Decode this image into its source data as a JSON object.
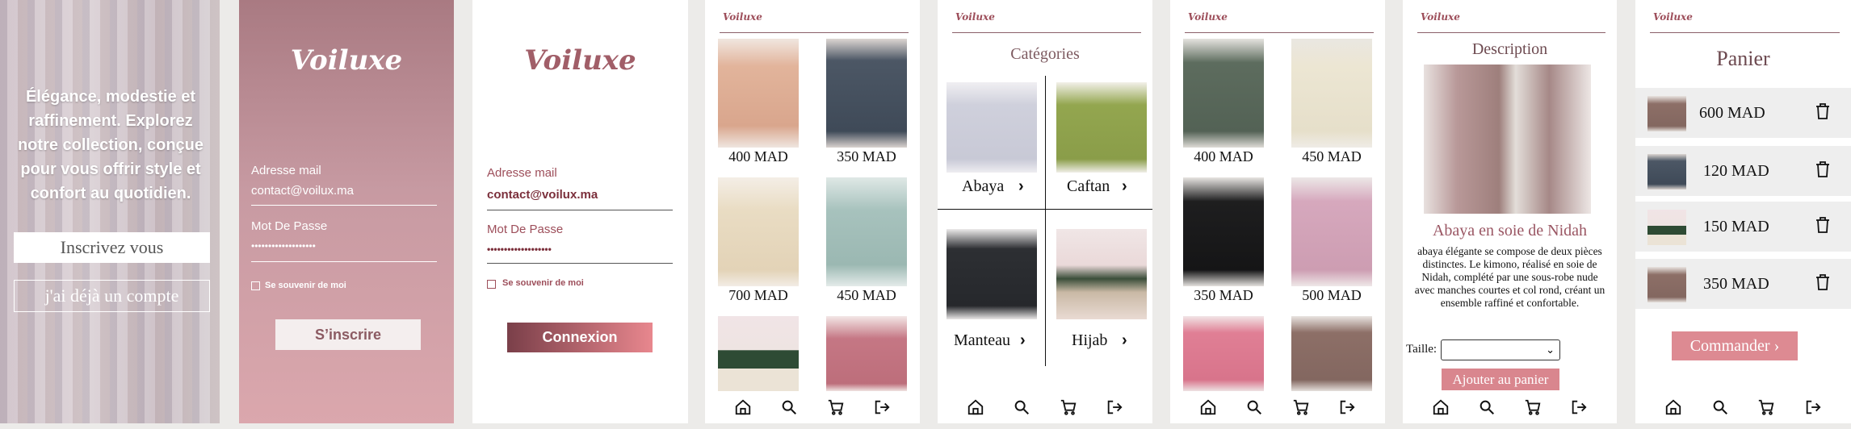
{
  "brand": "Voiluxe",
  "welcome": {
    "tagline": "Élégance, modestie et raffinement. Explorez notre collection, conçue pour vous offrir style et confort au quotidien.",
    "register_btn": "Inscrivez vous",
    "login_btn": "j'ai déjà un compte"
  },
  "register": {
    "email_label": "Adresse mail",
    "email_value": "contact@voilux.ma",
    "password_label": "Mot De Passe",
    "password_value": "•••••••••••••••••••",
    "remember_label": "Se souvenir de moi",
    "submit": "S’inscrire"
  },
  "login": {
    "email_label": "Adresse mail",
    "email_value": "contact@voilux.ma",
    "password_label": "Mot De Passe",
    "password_value": "•••••••••••••••••••",
    "remember_label": "Se souvenir de moi",
    "submit": "Connexion"
  },
  "catalog1": {
    "products": [
      {
        "price": "400 MAD",
        "color": "peach"
      },
      {
        "price": "350 MAD",
        "color": "slate"
      },
      {
        "price": "700 MAD",
        "color": "beige"
      },
      {
        "price": "450 MAD",
        "color": "mint"
      },
      {
        "price": "",
        "color": "box"
      },
      {
        "price": "",
        "color": "rose"
      }
    ]
  },
  "categories": {
    "title": "Catégories",
    "items": [
      {
        "label": "Abaya"
      },
      {
        "label": "Caftan"
      },
      {
        "label": "Manteau"
      },
      {
        "label": "Hijab"
      }
    ]
  },
  "catalog2": {
    "products": [
      {
        "price": "400 MAD",
        "color": "olive"
      },
      {
        "price": "450 MAD",
        "color": "cream"
      },
      {
        "price": "350 MAD",
        "color": "black"
      },
      {
        "price": "500 MAD",
        "color": "pink"
      },
      {
        "price": "",
        "color": "hotpink"
      },
      {
        "price": "",
        "color": "taupe"
      }
    ]
  },
  "description": {
    "title": "Description",
    "product_name": "Abaya en soie de Nidah",
    "text": "abaya élégante se compose de deux pièces distinctes. Le kimono, réalisé en soie de Nidah, complété par une sous-robe nude avec manches courtes et col rond, créant un ensemble raffiné et confortable.",
    "size_label": "Taille:",
    "size_value": "",
    "add_to_cart": "Ajouter au panier"
  },
  "cart": {
    "title": "Panier",
    "items": [
      {
        "price": "600 MAD"
      },
      {
        "price": "120 MAD"
      },
      {
        "price": "150 MAD"
      },
      {
        "price": "350 MAD"
      }
    ],
    "order_btn": "Commander"
  },
  "nav_icons": [
    "home-icon",
    "search-icon",
    "cart-icon",
    "logout-icon"
  ],
  "colors": {
    "brand": "#9d4e5a",
    "accent_button": "#dd8a92",
    "register_bg": "#c79aa2"
  }
}
